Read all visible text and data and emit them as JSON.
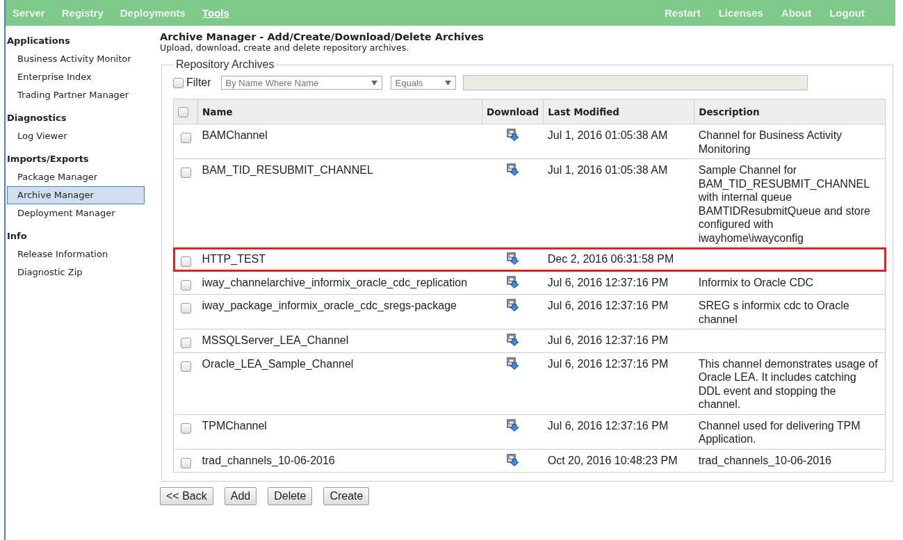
{
  "top_nav": {
    "left": [
      {
        "label": "Server",
        "selected": false
      },
      {
        "label": "Registry",
        "selected": false
      },
      {
        "label": "Deployments",
        "selected": false
      },
      {
        "label": "Tools",
        "selected": true
      }
    ],
    "right": [
      {
        "label": "Restart"
      },
      {
        "label": "Licenses"
      },
      {
        "label": "About"
      },
      {
        "label": "Logout"
      }
    ]
  },
  "sidebar": [
    {
      "heading": "Applications",
      "items": [
        {
          "label": "Business Activity Monitor",
          "selected": false
        },
        {
          "label": "Enterprise Index",
          "selected": false
        },
        {
          "label": "Trading Partner Manager",
          "selected": false
        }
      ]
    },
    {
      "heading": "Diagnostics",
      "items": [
        {
          "label": "Log Viewer",
          "selected": false
        }
      ]
    },
    {
      "heading": "Imports/Exports",
      "items": [
        {
          "label": "Package Manager",
          "selected": false
        },
        {
          "label": "Archive Manager",
          "selected": true
        },
        {
          "label": "Deployment Manager",
          "selected": false
        }
      ]
    },
    {
      "heading": "Info",
      "items": [
        {
          "label": "Release Information",
          "selected": false
        },
        {
          "label": "Diagnostic Zip",
          "selected": false
        }
      ]
    }
  ],
  "page": {
    "title": "Archive Manager - Add/Create/Download/Delete Archives",
    "subtitle": "Upload, download, create and delete repository archives."
  },
  "archives": {
    "legend": "Repository Archives",
    "filter": {
      "label": "Filter",
      "checked": false,
      "field_select": "By Name Where Name",
      "operator_select": "Equals"
    },
    "table": {
      "select_all_checked": false,
      "columns": [
        "Name",
        "Download",
        "Last Modified",
        "Description"
      ],
      "rows": [
        {
          "name": "BAMChannel",
          "modified": "Jul 1, 2016 01:05:38 AM",
          "description": "Channel for Business Activity Monitoring",
          "checked": false,
          "highlighted": false
        },
        {
          "name": "BAM_TID_RESUBMIT_CHANNEL",
          "modified": "Jul 1, 2016 01:05:38 AM",
          "description": "Sample Channel for BAM_TID_RESUBMIT_CHANNEL with internal queue BAMTIDResubmitQueue and store configured with iwayhome\\iwayconfig",
          "checked": false,
          "highlighted": false
        },
        {
          "name": "HTTP_TEST",
          "modified": "Dec 2, 2016 06:31:58 PM",
          "checked": false,
          "highlighted": true
        },
        {
          "name": "iway_channelarchive_informix_oracle_cdc_replication",
          "modified": "Jul 6, 2016 12:37:16 PM",
          "description": "Informix to Oracle CDC",
          "checked": false,
          "highlighted": false
        },
        {
          "name": "iway_package_informix_oracle_cdc_sregs-package",
          "modified": "Jul 6, 2016 12:37:16 PM",
          "description": "SREG s informix cdc to Oracle channel",
          "checked": false,
          "highlighted": false
        },
        {
          "name": "MSSQLServer_LEA_Channel",
          "modified": "Jul 6, 2016 12:37:16 PM",
          "checked": false,
          "highlighted": false
        },
        {
          "name": "Oracle_LEA_Sample_Channel",
          "modified": "Jul 6, 2016 12:37:16 PM",
          "description": "This channel demonstrates usage of Oracle LEA. It includes catching DDL event and stopping the channel.",
          "checked": false,
          "highlighted": false
        },
        {
          "name": "TPMChannel",
          "modified": "Jul 6, 2016 12:37:16 PM",
          "description": "Channel used for delivering TPM Application.",
          "checked": false,
          "highlighted": false
        },
        {
          "name": "trad_channels_10-06-2016",
          "modified": "Oct 20, 2016 10:48:23 PM",
          "description": "trad_channels_10-06-2016",
          "checked": false,
          "highlighted": false
        }
      ]
    }
  },
  "buttons": [
    "<< Back",
    "Add",
    "Delete",
    "Create"
  ]
}
